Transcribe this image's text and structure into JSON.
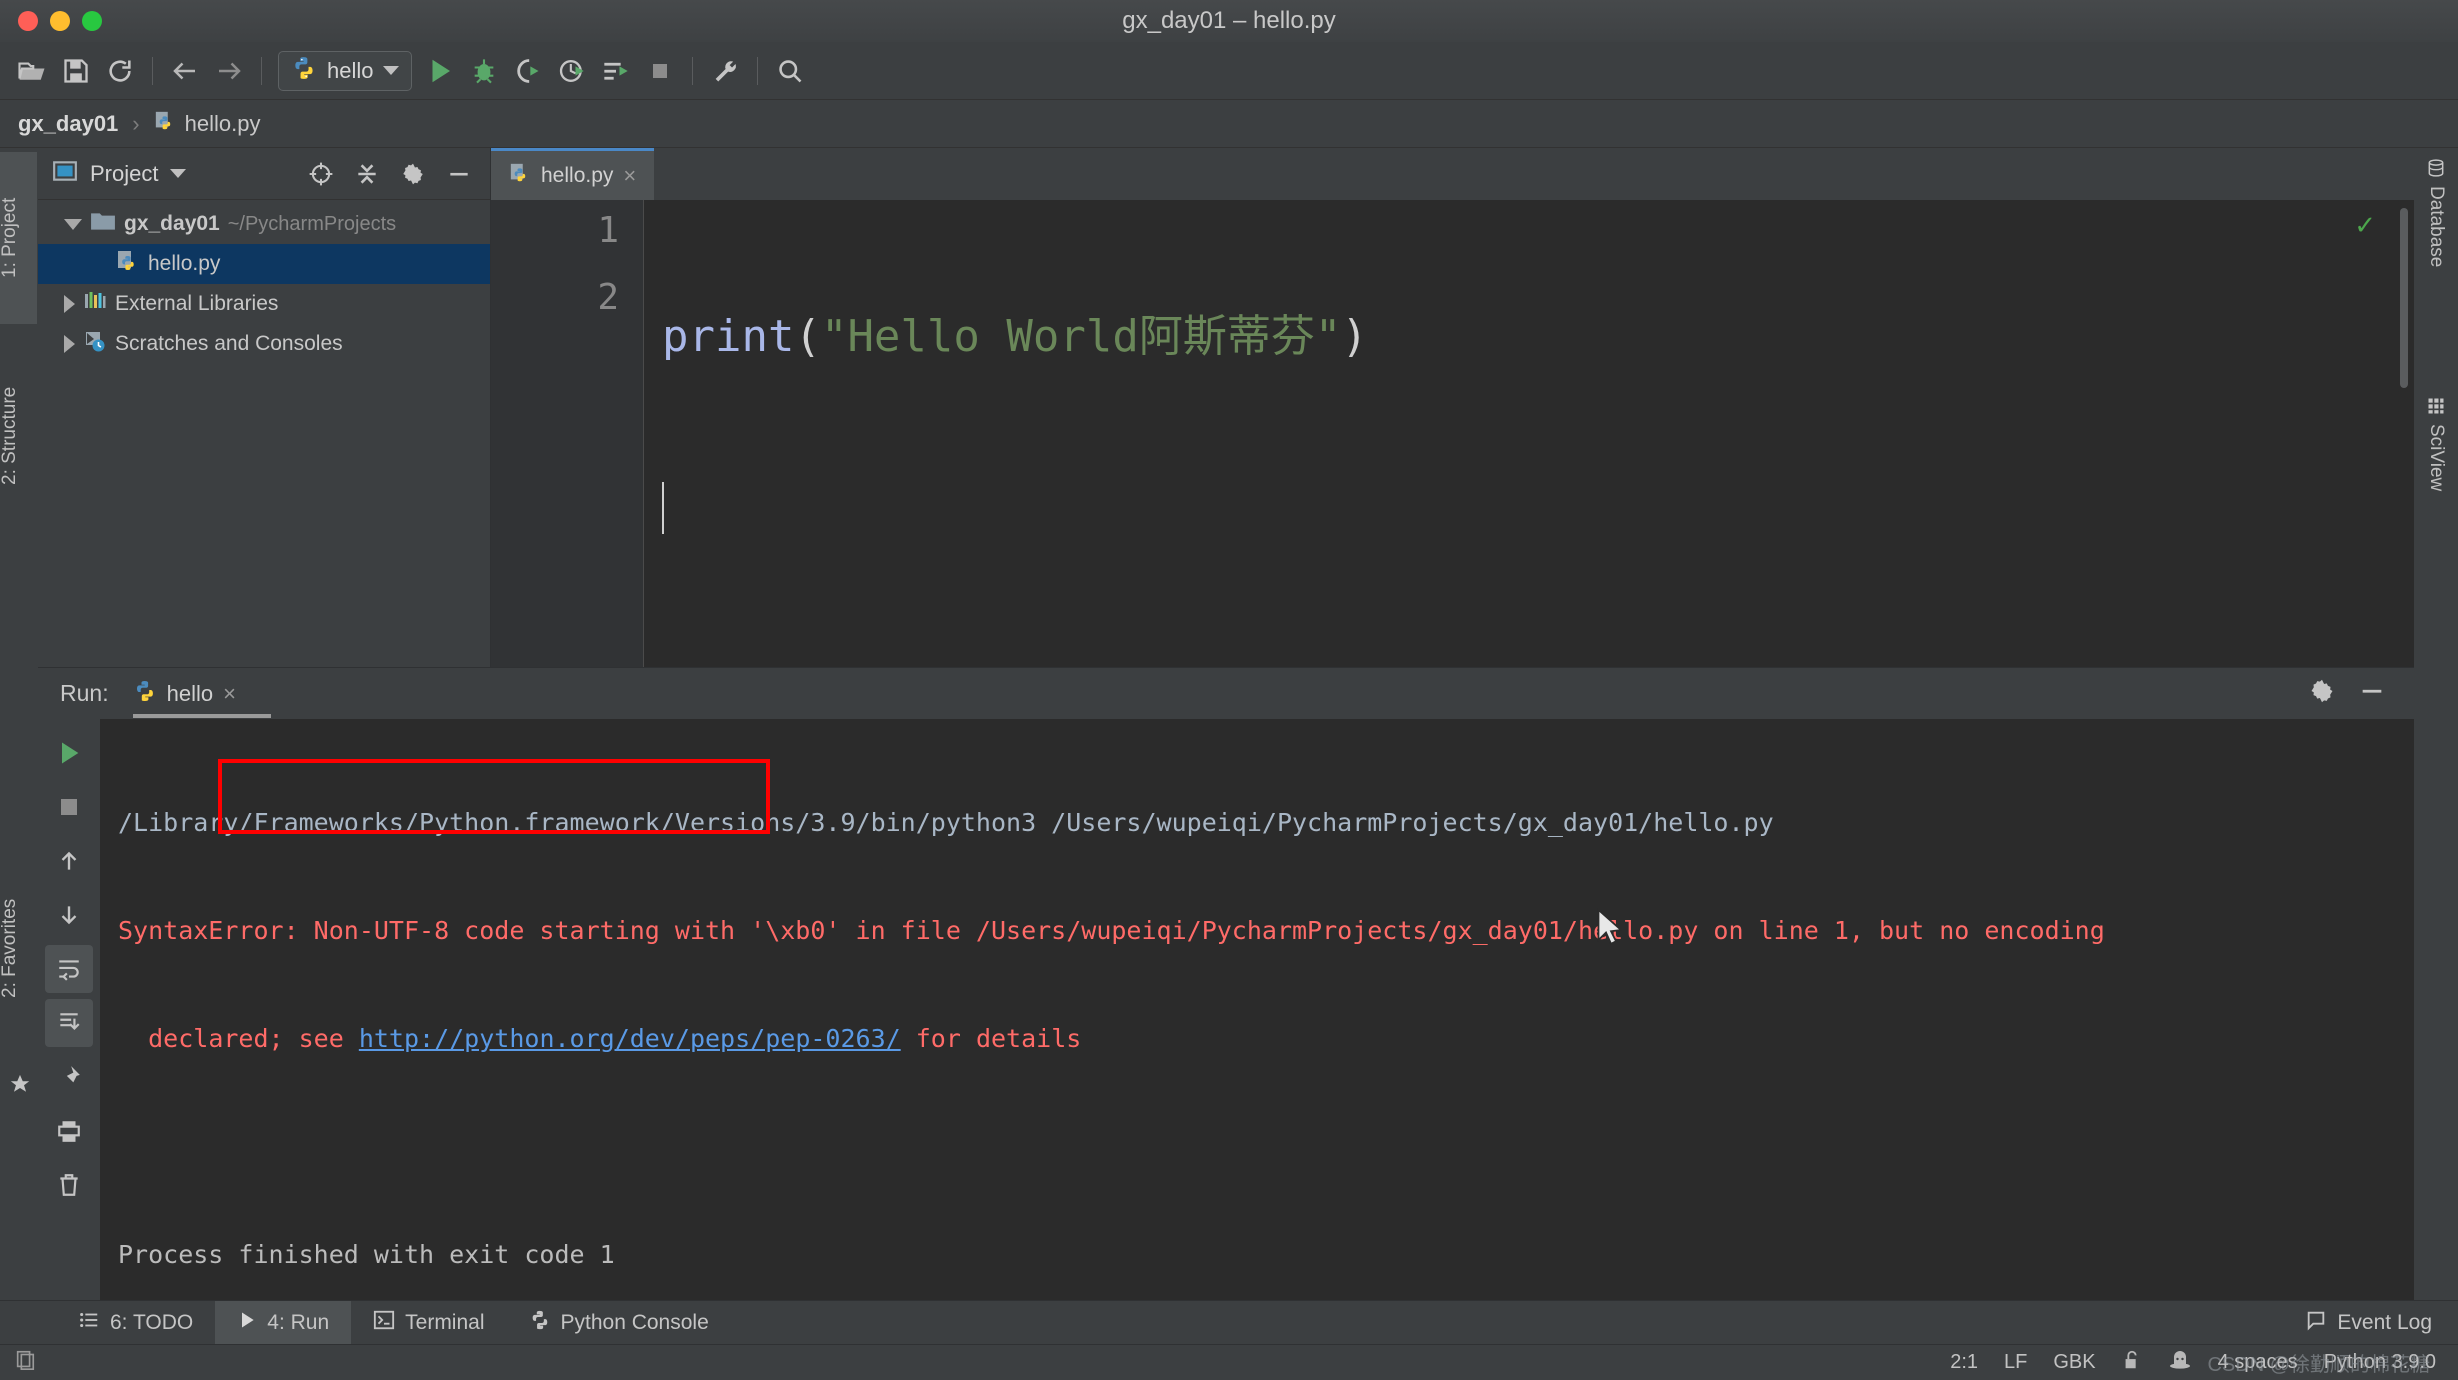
{
  "window": {
    "title": "gx_day01 – hello.py",
    "traffic_lights": [
      "close",
      "minimize",
      "zoom"
    ]
  },
  "toolbar": {
    "icons": [
      "open-folder-icon",
      "save-icon",
      "sync-icon",
      "back-arrow-icon",
      "forward-arrow-icon"
    ],
    "run_config": {
      "name": "hello",
      "icon": "python-file-icon"
    },
    "actions": [
      "run-icon",
      "debug-icon",
      "run-coverage-icon",
      "profile-icon",
      "run-with-console-icon",
      "stop-icon",
      "settings-wrench-icon",
      "search-icon"
    ]
  },
  "breadcrumb": {
    "project": "gx_day01",
    "separator": "›",
    "file": "hello.py"
  },
  "left_rail": {
    "items": [
      {
        "label": "1: Project",
        "selected": true
      },
      {
        "label": "2: Structure",
        "selected": false
      },
      {
        "label": "2: Favorites",
        "selected": false
      }
    ]
  },
  "right_rail": {
    "items": [
      {
        "label": "Database",
        "icon": "database-icon"
      },
      {
        "label": "SciView",
        "icon": "grid-icon"
      }
    ]
  },
  "project_panel": {
    "title": "Project",
    "header_icons": [
      "locate-target-icon",
      "collapse-all-icon",
      "gear-icon",
      "minimize-icon"
    ],
    "tree": [
      {
        "name": "gx_day01",
        "path": "~/PycharmProjects",
        "icon": "folder-icon",
        "expanded": true,
        "selected": false
      },
      {
        "name": "hello.py",
        "path": "",
        "icon": "python-file-icon",
        "expanded": false,
        "selected": true
      },
      {
        "name": "External Libraries",
        "path": "",
        "icon": "libraries-icon",
        "expanded": false,
        "selected": false
      },
      {
        "name": "Scratches and Consoles",
        "path": "",
        "icon": "scratches-icon",
        "expanded": false,
        "selected": false
      }
    ]
  },
  "editor": {
    "tab": {
      "label": "hello.py",
      "icon": "python-file-icon",
      "close": "×"
    },
    "inspection_status": "✓",
    "lines": [
      {
        "number": "1",
        "tokens": [
          {
            "type": "fn",
            "text": "print"
          },
          {
            "type": "paren",
            "text": "("
          },
          {
            "type": "str",
            "text": "\"Hello World阿斯蒂芬\""
          },
          {
            "type": "paren",
            "text": ")"
          }
        ]
      },
      {
        "number": "2",
        "tokens": []
      }
    ]
  },
  "run_panel": {
    "label": "Run:",
    "tab": {
      "label": "hello",
      "icon": "python-icon",
      "close": "×"
    },
    "header_icons": [
      "gear-icon",
      "minimize-icon"
    ],
    "side_actions": [
      "rerun-icon",
      "stop-icon",
      "up-arrow-icon",
      "down-arrow-icon",
      "soft-wrap-icon",
      "print-icon",
      "scroll-to-end-icon",
      "pin-icon",
      "trash-icon"
    ],
    "console": {
      "command": "/Library/Frameworks/Python.framework/Versions/3.9/bin/python3 /Users/wupeiqi/PycharmProjects/gx_day01/hello.py",
      "error_line_1": "SyntaxError: Non-UTF-8 code starting with '\\xb0' in file /Users/wupeiqi/PycharmProjects/gx_day01/hello.py on line 1, but no encoding",
      "error_line_2_prefix": "  declared; see ",
      "error_link": "http://python.org/dev/peps/pep-0263/",
      "error_line_2_suffix": " for details",
      "exit_message": "Process finished with exit code 1"
    }
  },
  "bottom_bar": {
    "items": [
      {
        "label": "6: TODO",
        "icon": "todo-list-icon",
        "active": false,
        "mnemonic": "6"
      },
      {
        "label": "4: Run",
        "icon": "run-triangle-icon",
        "active": true,
        "mnemonic": "4"
      },
      {
        "label": "Terminal",
        "icon": "terminal-icon",
        "active": false,
        "mnemonic": ""
      },
      {
        "label": "Python Console",
        "icon": "python-icon",
        "active": false,
        "mnemonic": ""
      }
    ],
    "event_log": {
      "label": "Event Log",
      "icon": "balloon-icon"
    }
  },
  "status_bar": {
    "caret_position": "2:1",
    "line_separator": "LF",
    "encoding": "GBK",
    "lock_icon": "unlocked-padlock-icon",
    "hat_icon": "hector-hat-icon",
    "indent": "4 spaces",
    "interpreter": "Python 3.9.0",
    "watermark": "CSDN @徐勤顺的棉花糖"
  },
  "colors": {
    "accent_blue": "#4a88c7",
    "selection_blue": "#0d3761",
    "error_red": "#ff6b68",
    "annotation_red": "#ff0000",
    "string_green": "#6a8759",
    "keyword_purple": "#a9b7e8",
    "link_blue": "#5a9ae6",
    "panel_bg": "#3c3f41",
    "editor_bg": "#2b2b2b"
  }
}
